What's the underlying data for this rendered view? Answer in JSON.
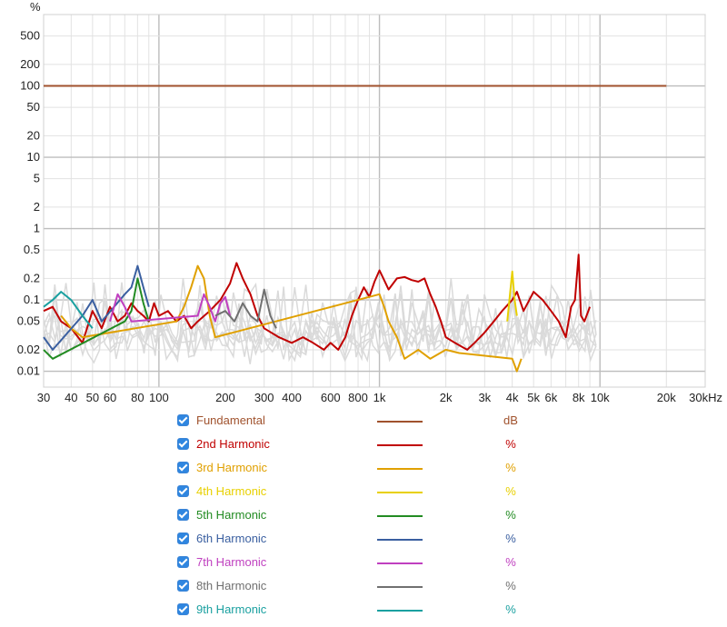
{
  "chart_data": {
    "type": "line",
    "title": "",
    "xlabel": "",
    "ylabel": "%",
    "x_scale": "log",
    "y_scale": "log",
    "xlim": [
      30,
      30000
    ],
    "ylim": [
      0.006,
      1000
    ],
    "x_ticks": [
      {
        "v": 30,
        "label": "30"
      },
      {
        "v": 40,
        "label": "40"
      },
      {
        "v": 50,
        "label": "50"
      },
      {
        "v": 60,
        "label": "60"
      },
      {
        "v": 80,
        "label": "80"
      },
      {
        "v": 100,
        "label": "100"
      },
      {
        "v": 200,
        "label": "200"
      },
      {
        "v": 300,
        "label": "300"
      },
      {
        "v": 400,
        "label": "400"
      },
      {
        "v": 600,
        "label": "600"
      },
      {
        "v": 800,
        "label": "800"
      },
      {
        "v": 1000,
        "label": "1k"
      },
      {
        "v": 2000,
        "label": "2k"
      },
      {
        "v": 3000,
        "label": "3k"
      },
      {
        "v": 4000,
        "label": "4k"
      },
      {
        "v": 5000,
        "label": "5k"
      },
      {
        "v": 6000,
        "label": "6k"
      },
      {
        "v": 8000,
        "label": "8k"
      },
      {
        "v": 10000,
        "label": "10k"
      },
      {
        "v": 20000,
        "label": "20k"
      },
      {
        "v": 30000,
        "label": "30kHz"
      }
    ],
    "y_ticks": [
      {
        "v": 500,
        "label": "500"
      },
      {
        "v": 200,
        "label": "200"
      },
      {
        "v": 100,
        "label": "100"
      },
      {
        "v": 50,
        "label": "50"
      },
      {
        "v": 20,
        "label": "20"
      },
      {
        "v": 10,
        "label": "10"
      },
      {
        "v": 5,
        "label": "5"
      },
      {
        "v": 2,
        "label": "2"
      },
      {
        "v": 1,
        "label": "1"
      },
      {
        "v": 0.5,
        "label": "0.5"
      },
      {
        "v": 0.2,
        "label": "0.2"
      },
      {
        "v": 0.1,
        "label": "0.1"
      },
      {
        "v": 0.05,
        "label": "0.05"
      },
      {
        "v": 0.02,
        "label": "0.02"
      },
      {
        "v": 0.01,
        "label": "0.01"
      }
    ],
    "grid": true,
    "legend_position": "bottom",
    "series": [
      {
        "name": "Fundamental",
        "unit": "dB",
        "color": "#a0522d",
        "points": [
          [
            30,
            100
          ],
          [
            20000,
            100
          ]
        ]
      },
      {
        "name": "2nd Harmonic",
        "unit": "%",
        "color": "#c00000",
        "points": [
          [
            30,
            0.07
          ],
          [
            33,
            0.08
          ],
          [
            36,
            0.05
          ],
          [
            40,
            0.04
          ],
          [
            45,
            0.025
          ],
          [
            50,
            0.07
          ],
          [
            55,
            0.04
          ],
          [
            60,
            0.08
          ],
          [
            65,
            0.05
          ],
          [
            70,
            0.06
          ],
          [
            75,
            0.09
          ],
          [
            80,
            0.07
          ],
          [
            85,
            0.06
          ],
          [
            90,
            0.05
          ],
          [
            95,
            0.09
          ],
          [
            100,
            0.06
          ],
          [
            110,
            0.07
          ],
          [
            120,
            0.05
          ],
          [
            130,
            0.06
          ],
          [
            140,
            0.04
          ],
          [
            150,
            0.05
          ],
          [
            170,
            0.07
          ],
          [
            190,
            0.1
          ],
          [
            210,
            0.17
          ],
          [
            225,
            0.33
          ],
          [
            240,
            0.2
          ],
          [
            260,
            0.12
          ],
          [
            280,
            0.06
          ],
          [
            300,
            0.04
          ],
          [
            350,
            0.03
          ],
          [
            400,
            0.025
          ],
          [
            450,
            0.03
          ],
          [
            500,
            0.025
          ],
          [
            560,
            0.02
          ],
          [
            600,
            0.025
          ],
          [
            650,
            0.02
          ],
          [
            700,
            0.03
          ],
          [
            750,
            0.06
          ],
          [
            800,
            0.1
          ],
          [
            850,
            0.15
          ],
          [
            900,
            0.11
          ],
          [
            950,
            0.18
          ],
          [
            1000,
            0.26
          ],
          [
            1050,
            0.19
          ],
          [
            1100,
            0.14
          ],
          [
            1200,
            0.2
          ],
          [
            1300,
            0.21
          ],
          [
            1400,
            0.19
          ],
          [
            1500,
            0.18
          ],
          [
            1600,
            0.2
          ],
          [
            1700,
            0.12
          ],
          [
            1800,
            0.08
          ],
          [
            1900,
            0.05
          ],
          [
            2000,
            0.03
          ],
          [
            2200,
            0.025
          ],
          [
            2500,
            0.02
          ],
          [
            2700,
            0.025
          ],
          [
            3000,
            0.035
          ],
          [
            3300,
            0.05
          ],
          [
            3600,
            0.07
          ],
          [
            4000,
            0.1
          ],
          [
            4200,
            0.13
          ],
          [
            4500,
            0.07
          ],
          [
            4700,
            0.09
          ],
          [
            5000,
            0.13
          ],
          [
            5500,
            0.1
          ],
          [
            6000,
            0.07
          ],
          [
            6500,
            0.05
          ],
          [
            7000,
            0.03
          ],
          [
            7400,
            0.08
          ],
          [
            7700,
            0.1
          ],
          [
            8000,
            0.43
          ],
          [
            8200,
            0.06
          ],
          [
            8500,
            0.05
          ],
          [
            9000,
            0.08
          ]
        ]
      },
      {
        "name": "3rd Harmonic",
        "unit": "%",
        "color": "#e0a000",
        "points": [
          [
            36,
            0.06
          ],
          [
            40,
            0.04
          ],
          [
            45,
            0.03
          ],
          [
            120,
            0.05
          ],
          [
            130,
            0.08
          ],
          [
            140,
            0.15
          ],
          [
            150,
            0.3
          ],
          [
            160,
            0.2
          ],
          [
            170,
            0.06
          ],
          [
            180,
            0.03
          ],
          [
            1000,
            0.12
          ],
          [
            1050,
            0.08
          ],
          [
            1100,
            0.05
          ],
          [
            1200,
            0.03
          ],
          [
            1300,
            0.015
          ],
          [
            1500,
            0.02
          ],
          [
            1700,
            0.015
          ],
          [
            2000,
            0.02
          ],
          [
            2300,
            0.018
          ],
          [
            4000,
            0.015
          ],
          [
            4200,
            0.01
          ],
          [
            4400,
            0.015
          ]
        ]
      },
      {
        "name": "4th Harmonic",
        "unit": "%",
        "color": "#e8d000",
        "points": [
          [
            3800,
            0.05
          ],
          [
            4000,
            0.25
          ],
          [
            4100,
            0.1
          ],
          [
            4200,
            0.06
          ]
        ]
      },
      {
        "name": "5th Harmonic",
        "unit": "%",
        "color": "#228b22",
        "points": [
          [
            30,
            0.02
          ],
          [
            33,
            0.015
          ],
          [
            70,
            0.05
          ],
          [
            75,
            0.07
          ],
          [
            80,
            0.2
          ],
          [
            85,
            0.09
          ],
          [
            90,
            0.05
          ]
        ]
      },
      {
        "name": "6th Harmonic",
        "unit": "%",
        "color": "#3a5fa0",
        "points": [
          [
            30,
            0.03
          ],
          [
            33,
            0.02
          ],
          [
            45,
            0.06
          ],
          [
            50,
            0.1
          ],
          [
            55,
            0.05
          ],
          [
            70,
            0.12
          ],
          [
            75,
            0.15
          ],
          [
            80,
            0.3
          ],
          [
            85,
            0.15
          ],
          [
            90,
            0.08
          ]
        ]
      },
      {
        "name": "7th Harmonic",
        "unit": "%",
        "color": "#c040c0",
        "points": [
          [
            60,
            0.05
          ],
          [
            65,
            0.12
          ],
          [
            70,
            0.08
          ],
          [
            75,
            0.05
          ],
          [
            150,
            0.06
          ],
          [
            160,
            0.12
          ],
          [
            170,
            0.08
          ],
          [
            180,
            0.05
          ],
          [
            190,
            0.09
          ],
          [
            200,
            0.11
          ],
          [
            210,
            0.06
          ]
        ]
      },
      {
        "name": "8th Harmonic",
        "unit": "%",
        "color": "#707070",
        "points": [
          [
            180,
            0.06
          ],
          [
            200,
            0.07
          ],
          [
            220,
            0.05
          ],
          [
            240,
            0.09
          ],
          [
            260,
            0.06
          ],
          [
            280,
            0.05
          ],
          [
            300,
            0.14
          ],
          [
            320,
            0.06
          ],
          [
            340,
            0.04
          ]
        ]
      },
      {
        "name": "9th Harmonic",
        "unit": "%",
        "color": "#1aa0a0",
        "points": [
          [
            30,
            0.08
          ],
          [
            33,
            0.1
          ],
          [
            36,
            0.13
          ],
          [
            40,
            0.1
          ],
          [
            45,
            0.06
          ],
          [
            50,
            0.04
          ]
        ]
      }
    ]
  },
  "legend": [
    {
      "label": "Fundamental",
      "unit": "dB",
      "color": "#a0522d"
    },
    {
      "label": "2nd Harmonic",
      "unit": "%",
      "color": "#c00000"
    },
    {
      "label": "3rd Harmonic",
      "unit": "%",
      "color": "#e0a000"
    },
    {
      "label": "4th Harmonic",
      "unit": "%",
      "color": "#e8d000"
    },
    {
      "label": "5th Harmonic",
      "unit": "%",
      "color": "#228b22"
    },
    {
      "label": "6th Harmonic",
      "unit": "%",
      "color": "#3a5fa0"
    },
    {
      "label": "7th Harmonic",
      "unit": "%",
      "color": "#c040c0"
    },
    {
      "label": "8th Harmonic",
      "unit": "%",
      "color": "#707070"
    },
    {
      "label": "9th Harmonic",
      "unit": "%",
      "color": "#1aa0a0"
    }
  ]
}
